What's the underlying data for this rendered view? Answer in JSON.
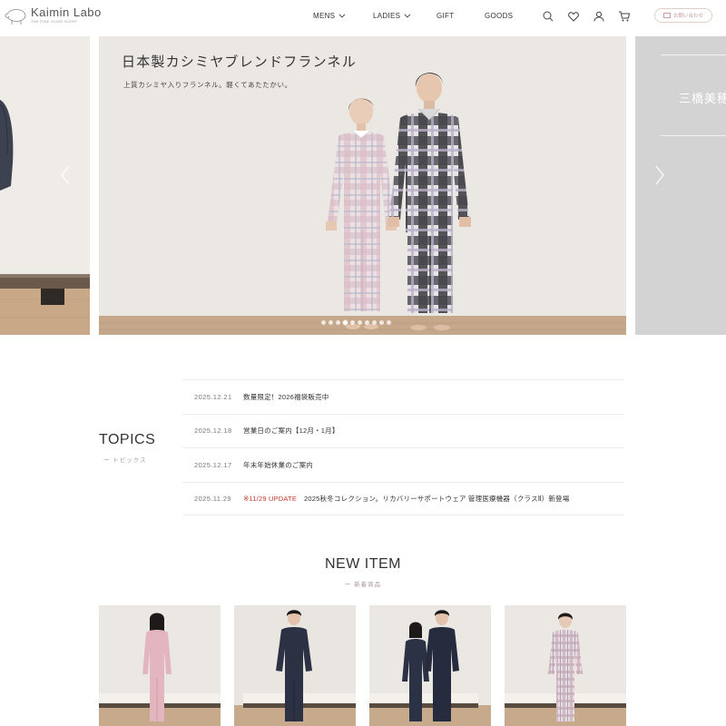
{
  "header": {
    "logo_name": "Kaimin Labo",
    "logo_tagline": "THE FINE GOOD SLEEP",
    "nav": [
      {
        "label": "MENS",
        "has_dropdown": true
      },
      {
        "label": "LADIES",
        "has_dropdown": true
      },
      {
        "label": "GIFT",
        "has_dropdown": false
      },
      {
        "label": "GOODS",
        "has_dropdown": false
      }
    ],
    "icons": [
      "search-icon",
      "heart-icon",
      "user-icon",
      "cart-icon"
    ],
    "contact_label": "お問い合わせ"
  },
  "hero": {
    "title": "日本製カシミヤブレンドフランネル",
    "subtitle": "上質カシミヤ入りフランネル。軽くてあたたかい。",
    "right_slide_text": "三橋美穂",
    "dot_count": 10,
    "active_dot": 3
  },
  "topics": {
    "title": "TOPICS",
    "subtitle": "ー トピックス",
    "items": [
      {
        "date": "2025.12.21",
        "tag": "",
        "text": "数量限定！2026福袋販売中"
      },
      {
        "date": "2025.12.18",
        "tag": "",
        "text": "営業日のご案内【12月・1月】"
      },
      {
        "date": "2025.12.17",
        "tag": "",
        "text": "年末年始休業のご案内"
      },
      {
        "date": "2025.11.29",
        "tag": "※11/29 UPDATE",
        "text": "2025秋冬コレクション。リカバリーサポートウェア 管理医療機器（クラスⅡ）新登場"
      }
    ]
  },
  "new_item": {
    "title": "NEW ITEM",
    "subtitle": "ー 新着商品"
  },
  "colors": {
    "accent_red": "#c0392b",
    "sub_label": "#aa9999",
    "contact_border": "#e3cfc4"
  }
}
